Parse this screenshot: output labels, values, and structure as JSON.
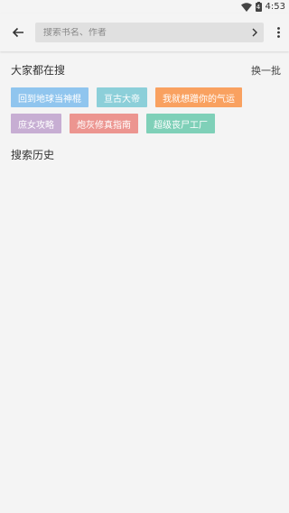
{
  "status_bar": {
    "battery_level": "4",
    "time": "4:53"
  },
  "toolbar": {
    "search_placeholder": "搜索书名、作者"
  },
  "hot_section": {
    "title": "大家都在搜",
    "refresh_label": "换一批",
    "tags": [
      {
        "label": "回到地球当神棍",
        "color": "#90c5ee"
      },
      {
        "label": "亘古大帝",
        "color": "#8ccfd9"
      },
      {
        "label": "我就想蹭你的气运",
        "color": "#f9a160"
      },
      {
        "label": "庶女攻略",
        "color": "#c7aed3"
      },
      {
        "label": "炮灰修真指南",
        "color": "#ec9590"
      },
      {
        "label": "超级丧尸工厂",
        "color": "#7fd0b8"
      }
    ]
  },
  "history_section": {
    "title": "搜索历史"
  }
}
